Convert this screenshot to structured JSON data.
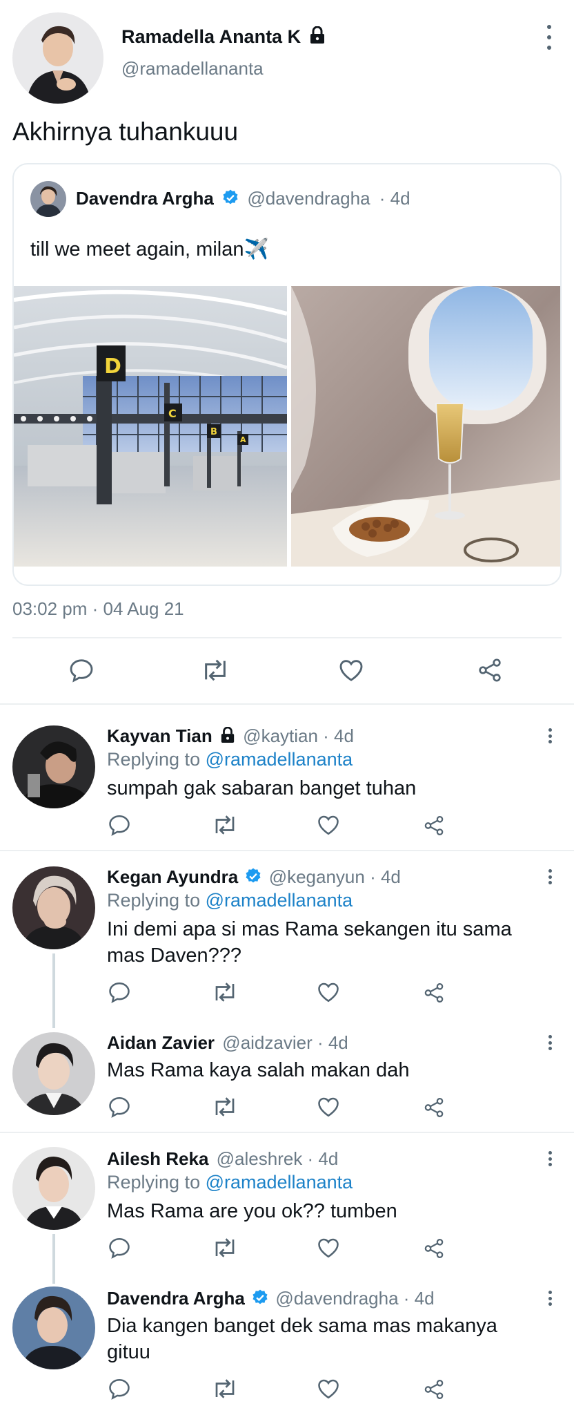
{
  "main_tweet": {
    "author_name": "Ramadella Ananta K",
    "author_handle": "@ramadellananta",
    "text": "Akhirnya tuhankuuu",
    "timestamp": "03:02 pm · 04 Aug 21",
    "quoted": {
      "author_name": "Davendra Argha",
      "author_handle": "@davendragha",
      "time": "· 4d",
      "text": "till we meet again, milan✈️",
      "images": [
        "airport-gates-image",
        "airplane-window-champagne-image"
      ]
    }
  },
  "actions": [
    "reply-icon",
    "retweet-icon",
    "like-icon",
    "share-icon"
  ],
  "replies": [
    {
      "name": "Kayvan Tian",
      "handle": "@kaytian · 4d",
      "replying_prefix": "Replying to ",
      "replying_to": "@ramadellananta",
      "text": "sumpah gak sabaran banget tuhan"
    },
    {
      "name": "Kegan Ayundra",
      "handle": "@keganyun · 4d",
      "replying_prefix": "Replying to ",
      "replying_to": "@ramadellananta",
      "text_line1": "Ini demi apa si mas Rama sekangen itu sama",
      "text_line2": "mas Daven???"
    },
    {
      "name": "Aidan Zavier",
      "handle": "@aidzavier · 4d",
      "text": "Mas Rama kaya salah makan dah"
    },
    {
      "name": "Ailesh Reka",
      "handle": "@aleshrek · 4d",
      "replying_prefix": "Replying to ",
      "replying_to": "@ramadellananta",
      "text": "Mas Rama are you ok?? tumben"
    },
    {
      "name": "Davendra Argha",
      "handle": "@davendragha · 4d",
      "text_line1": "Dia kangen banget dek sama mas makanya",
      "text_line2": "gituu"
    }
  ],
  "colors": {
    "link": "#1d82c8",
    "verified": "#1d9bf0",
    "secondary_text": "#6b7a86",
    "divider": "#eceff1"
  }
}
